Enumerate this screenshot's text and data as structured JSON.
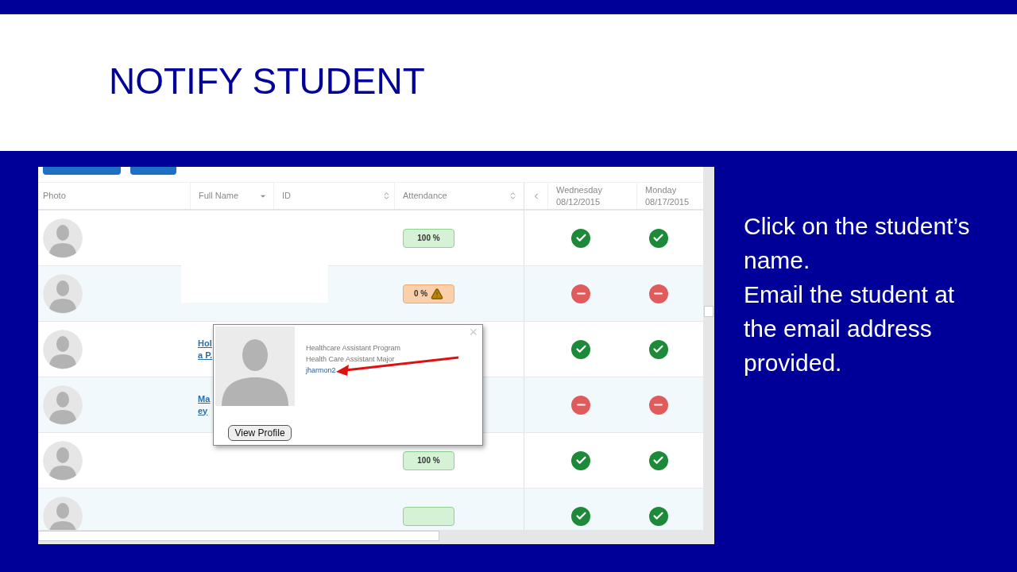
{
  "slide": {
    "title": "NOTIFY STUDENT",
    "notes": [
      "Click on the student’s name.",
      "Email the student at the email address provided."
    ]
  },
  "table": {
    "columns": [
      "Photo",
      "Full Name",
      "ID",
      "Attendance"
    ],
    "day_columns": [
      {
        "day": "Wednesday",
        "date": "08/12/2015"
      },
      {
        "day": "Monday",
        "date": "08/17/2015"
      }
    ],
    "rows": [
      {
        "name_lines": [],
        "attendance": {
          "text": "100 %",
          "kind": "good"
        },
        "days": [
          {
            "present": true
          },
          {
            "present": true
          }
        ]
      },
      {
        "name_lines": [],
        "redacted": true,
        "attendance": {
          "text": "0 %",
          "kind": "warning"
        },
        "days": [
          {
            "present": false
          },
          {
            "present": false
          }
        ]
      },
      {
        "name_lines": [
          "Hol",
          "a P."
        ],
        "days": [
          {
            "present": true
          },
          {
            "present": true
          }
        ]
      },
      {
        "name_lines": [
          "Ma",
          "ey"
        ],
        "days": [
          {
            "present": false
          },
          {
            "present": false
          }
        ]
      },
      {
        "name_lines": [],
        "attendance": {
          "text": "100 %",
          "kind": "good"
        },
        "days": [
          {
            "present": true
          },
          {
            "present": true
          }
        ]
      },
      {
        "name_lines": [],
        "attendance": {
          "kind": "good"
        },
        "days": [
          {
            "present": true
          },
          {
            "present": true
          }
        ]
      }
    ]
  },
  "popup": {
    "lines": [
      "Healthcare Assistant Program",
      "Health Care Assistant Major"
    ],
    "email": "jharmon2",
    "button": "View Profile",
    "close": "×"
  }
}
